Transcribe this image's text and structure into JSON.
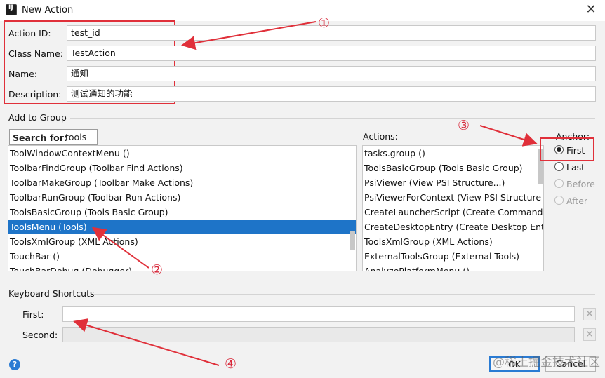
{
  "window": {
    "title": "New Action"
  },
  "form": {
    "action_id": {
      "label": "Action ID:",
      "value": "test_id"
    },
    "class_name": {
      "label": "Class Name:",
      "value": "TestAction"
    },
    "name": {
      "label": "Name:",
      "value": "通知"
    },
    "description": {
      "label": "Description:",
      "value": "测试通知的功能"
    }
  },
  "add_to_group": {
    "heading": "Add to Group",
    "search_label": "Search for:",
    "search_value": "tools",
    "groups": [
      "ToolWindowContextMenu ()",
      "ToolbarFindGroup (Toolbar Find Actions)",
      "ToolbarMakeGroup (Toolbar Make Actions)",
      "ToolbarRunGroup (Toolbar Run Actions)",
      "ToolsBasicGroup (Tools Basic Group)",
      "ToolsMenu (Tools)",
      "ToolsXmlGroup (XML Actions)",
      "TouchBar ()",
      "TouchBarDebug (Debugger)"
    ],
    "selected_group": "ToolsMenu (Tools)",
    "actions_label": "Actions:",
    "actions": [
      "tasks.group ()",
      "ToolsBasicGroup (Tools Basic Group)",
      "PsiViewer (View PSI Structure...)",
      "PsiViewerForContext (View PSI Structure of C",
      "CreateLauncherScript (Create Command-line",
      "CreateDesktopEntry (Create Desktop Entry...",
      "ToolsXmlGroup (XML Actions)",
      "ExternalToolsGroup (External Tools)",
      "AnalyzePlatformMenu ()"
    ],
    "anchor_label": "Anchor:",
    "anchors": [
      "First",
      "Last",
      "Before",
      "After"
    ],
    "anchor_selected": "First"
  },
  "shortcuts": {
    "heading": "Keyboard Shortcuts",
    "first_label": "First:",
    "second_label": "Second:",
    "first_value": "",
    "second_value": ""
  },
  "buttons": {
    "ok": "OK",
    "cancel": "Cancel"
  },
  "annotations": [
    "①",
    "②",
    "③",
    "④"
  ],
  "watermark": "@稀土掘金技术社区",
  "colors": {
    "annotation_red": "#e0303a",
    "selection_blue": "#1e74c8"
  }
}
